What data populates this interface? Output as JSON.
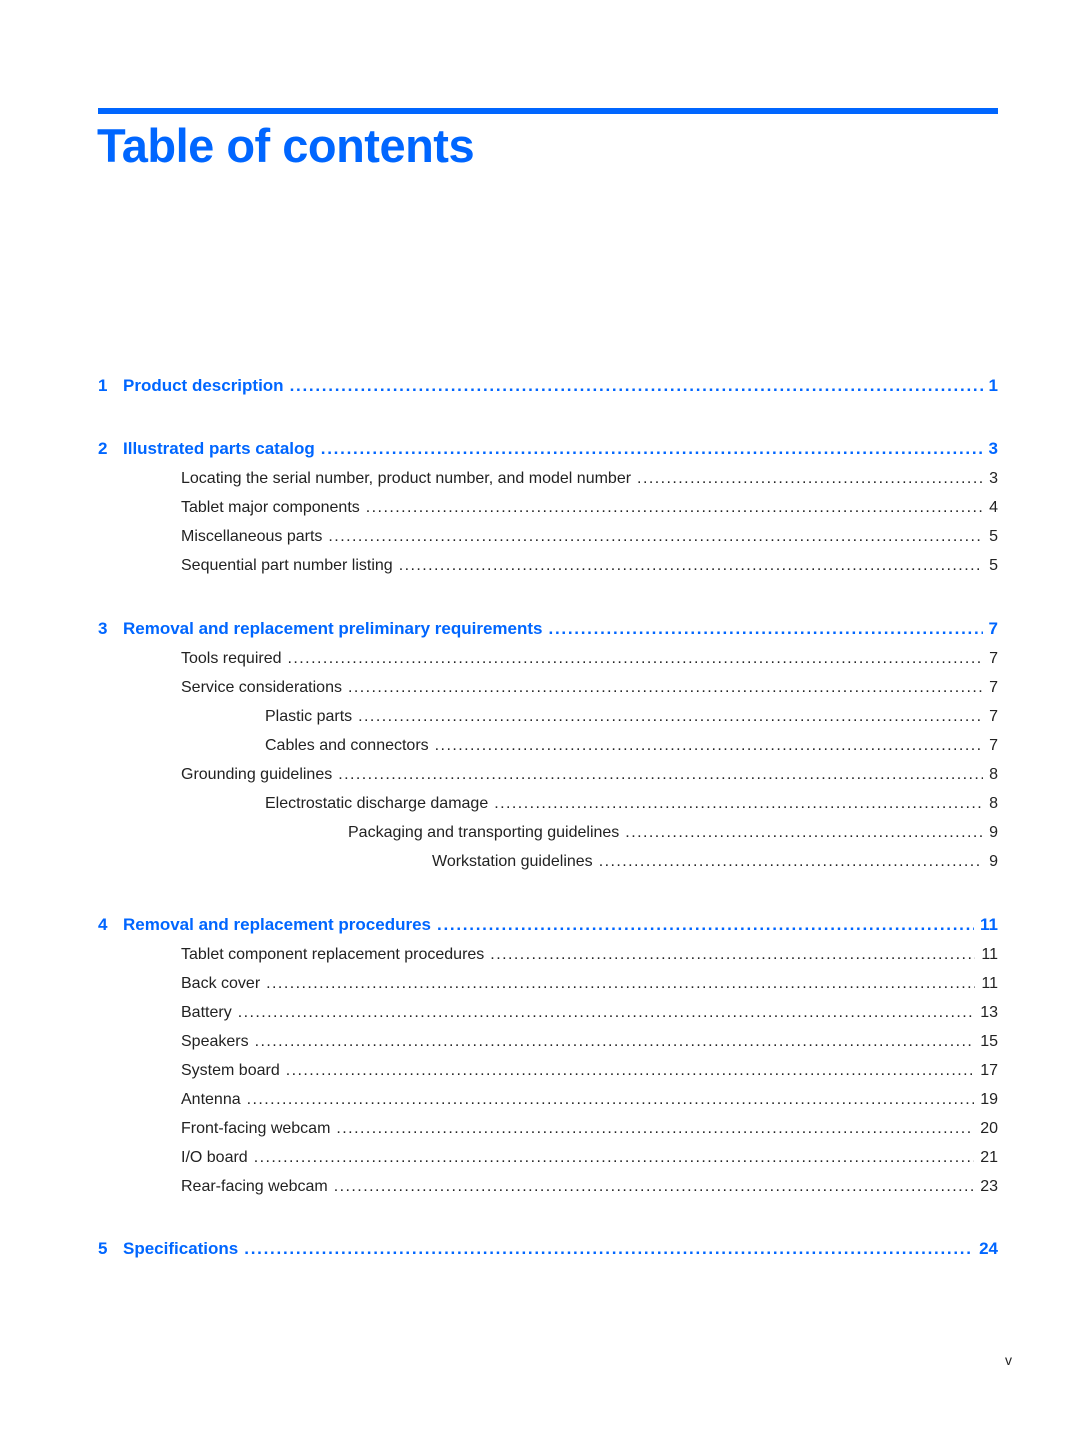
{
  "header": {
    "title": "Table of contents"
  },
  "entries": [
    {
      "type": "chapter",
      "num": "1",
      "label": "Product description",
      "page": "1"
    },
    {
      "type": "chapter",
      "num": "2",
      "label": "Illustrated parts catalog",
      "page": "3"
    },
    {
      "type": "section",
      "level": 1,
      "label": "Locating the serial number, product number, and model number",
      "page": "3"
    },
    {
      "type": "section",
      "level": 1,
      "label": "Tablet major components",
      "page": "4"
    },
    {
      "type": "section",
      "level": 1,
      "label": "Miscellaneous parts",
      "page": "5"
    },
    {
      "type": "section",
      "level": 1,
      "label": "Sequential part number listing",
      "page": "5"
    },
    {
      "type": "chapter",
      "num": "3",
      "label": "Removal and replacement preliminary requirements",
      "page": "7"
    },
    {
      "type": "section",
      "level": 1,
      "label": "Tools required",
      "page": "7"
    },
    {
      "type": "section",
      "level": 1,
      "label": "Service considerations",
      "page": "7"
    },
    {
      "type": "section",
      "level": 2,
      "label": "Plastic parts",
      "page": "7"
    },
    {
      "type": "section",
      "level": 2,
      "label": "Cables and connectors",
      "page": "7"
    },
    {
      "type": "section",
      "level": 1,
      "label": "Grounding guidelines",
      "page": "8"
    },
    {
      "type": "section",
      "level": 2,
      "label": "Electrostatic discharge damage",
      "page": "8"
    },
    {
      "type": "section",
      "level": 3,
      "label": "Packaging and transporting guidelines",
      "page": "9"
    },
    {
      "type": "section",
      "level": 4,
      "label": "Workstation guidelines",
      "page": "9"
    },
    {
      "type": "chapter",
      "num": "4",
      "label": "Removal and replacement procedures",
      "page": "11"
    },
    {
      "type": "section",
      "level": 1,
      "label": "Tablet component replacement procedures",
      "page": "11"
    },
    {
      "type": "section",
      "level": 1,
      "label": "Back cover",
      "page": "11"
    },
    {
      "type": "section",
      "level": 1,
      "label": "Battery",
      "page": "13"
    },
    {
      "type": "section",
      "level": 1,
      "label": "Speakers",
      "page": "15"
    },
    {
      "type": "section",
      "level": 1,
      "label": "System board",
      "page": "17"
    },
    {
      "type": "section",
      "level": 1,
      "label": "Antenna",
      "page": "19"
    },
    {
      "type": "section",
      "level": 1,
      "label": "Front-facing webcam",
      "page": "20"
    },
    {
      "type": "section",
      "level": 1,
      "label": "I/O board",
      "page": "21"
    },
    {
      "type": "section",
      "level": 1,
      "label": "Rear-facing webcam",
      "page": "23"
    },
    {
      "type": "chapter",
      "num": "5",
      "label": "Specifications",
      "page": "24"
    }
  ],
  "footer": {
    "page_number": "v"
  }
}
